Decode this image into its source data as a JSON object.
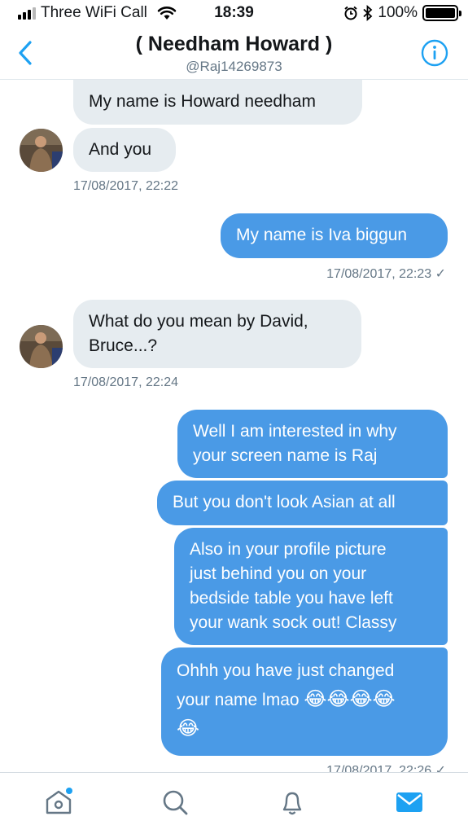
{
  "status": {
    "carrier": "Three WiFi Call",
    "time": "18:39",
    "battery": "100%"
  },
  "header": {
    "name": "( Needham Howard )",
    "handle": "@Raj14269873"
  },
  "messages": [
    {
      "dir": "received",
      "text": "My name is Howard needham"
    },
    {
      "dir": "received",
      "text": "And you"
    },
    {
      "dir": "timestamp",
      "text": "17/08/2017, 22:22"
    },
    {
      "dir": "sent",
      "text": "My name is Iva biggun"
    },
    {
      "dir": "timestamp",
      "text": "17/08/2017, 22:23 ✓"
    },
    {
      "dir": "received",
      "text_line1": "What do you mean by David,",
      "text_line2": "Bruce...?"
    },
    {
      "dir": "timestamp",
      "text": "17/08/2017, 22:24"
    },
    {
      "dir": "sent",
      "text_line1": "Well I am interested in why",
      "text_line2": "your screen name is Raj"
    },
    {
      "dir": "sent",
      "text": "But you don't look Asian at all"
    },
    {
      "dir": "sent",
      "text_line1": "Also in your profile picture",
      "text_line2": "just behind you on your",
      "text_line3": "bedside table you have left",
      "text_line4": "your wank sock out! Classy"
    },
    {
      "dir": "sent",
      "text_line1": "Ohhh you have just changed",
      "text_line2": "your name lmao",
      "emoji_line2": "😂😂😂😂",
      "emoji_line3": "😂"
    },
    {
      "dir": "timestamp",
      "text": "17/08/2017, 22:26 ✓"
    }
  ],
  "nav": {
    "items": [
      "home-icon",
      "search-icon",
      "notifications-icon",
      "messages-icon"
    ],
    "active": "messages-icon",
    "accent": "#1da1f2"
  },
  "colors": {
    "sent_bubble": "#4a9ae6",
    "received_bubble": "#e6ecf0",
    "accent": "#1da1f2"
  }
}
